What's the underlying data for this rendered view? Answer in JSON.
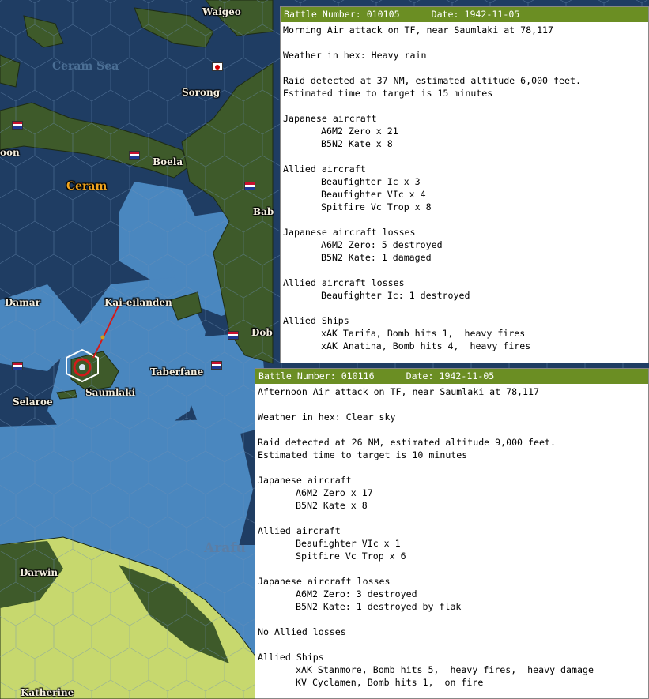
{
  "map": {
    "labels": {
      "waigeo": "Waigeo",
      "ceram_sea": "Ceram Sea",
      "sorong": "Sorong",
      "boela": "Boela",
      "ceram": "Ceram",
      "bab": "Bab",
      "oon": "oon",
      "damar": "Damar",
      "kai": "Kai-eilanden",
      "dob": "Dob",
      "taberfane": "Taberfane",
      "selaroe": "Selaroe",
      "saumlaki": "Saumlaki",
      "arafura": "Arafu",
      "darwin": "Darwin",
      "katherine": "Katherine"
    },
    "colors": {
      "deep_water": "#1f3d63",
      "shallow_water": "#4a87bf",
      "land": "#3e5a2a",
      "australia_land": "#c7d86e",
      "header_green": "#6b8e23"
    }
  },
  "report1": {
    "battle_number": "Battle Number: 010105",
    "date": "Date: 1942-11-05",
    "lines": [
      {
        "text": "Morning Air attack on TF, near Saumlaki at 78,117",
        "indent": false
      },
      {
        "text": "",
        "indent": false
      },
      {
        "text": "Weather in hex: Heavy rain",
        "indent": false
      },
      {
        "text": "",
        "indent": false
      },
      {
        "text": "Raid detected at 37 NM, estimated altitude 6,000 feet.",
        "indent": false
      },
      {
        "text": "Estimated time to target is 15 minutes",
        "indent": false
      },
      {
        "text": "",
        "indent": false
      },
      {
        "text": "Japanese aircraft",
        "indent": false
      },
      {
        "text": "A6M2 Zero x 21",
        "indent": true
      },
      {
        "text": "B5N2 Kate x 8",
        "indent": true
      },
      {
        "text": "",
        "indent": false
      },
      {
        "text": "Allied aircraft",
        "indent": false
      },
      {
        "text": "Beaufighter Ic x 3",
        "indent": true
      },
      {
        "text": "Beaufighter VIc x 4",
        "indent": true
      },
      {
        "text": "Spitfire Vc Trop x 8",
        "indent": true
      },
      {
        "text": "",
        "indent": false
      },
      {
        "text": "Japanese aircraft losses",
        "indent": false
      },
      {
        "text": "A6M2 Zero: 5 destroyed",
        "indent": true
      },
      {
        "text": "B5N2 Kate: 1 damaged",
        "indent": true
      },
      {
        "text": "",
        "indent": false
      },
      {
        "text": "Allied aircraft losses",
        "indent": false
      },
      {
        "text": "Beaufighter Ic: 1 destroyed",
        "indent": true
      },
      {
        "text": "",
        "indent": false
      },
      {
        "text": "Allied Ships",
        "indent": false
      },
      {
        "text": "xAK Tarifa, Bomb hits 1,  heavy fires",
        "indent": true
      },
      {
        "text": "xAK Anatina, Bomb hits 4,  heavy fires",
        "indent": true
      }
    ]
  },
  "report2": {
    "battle_number": "Battle Number: 010116",
    "date": "Date: 1942-11-05",
    "lines": [
      {
        "text": "Afternoon Air attack on TF, near Saumlaki at 78,117",
        "indent": false
      },
      {
        "text": "",
        "indent": false
      },
      {
        "text": "Weather in hex: Clear sky",
        "indent": false
      },
      {
        "text": "",
        "indent": false
      },
      {
        "text": "Raid detected at 26 NM, estimated altitude 9,000 feet.",
        "indent": false
      },
      {
        "text": "Estimated time to target is 10 minutes",
        "indent": false
      },
      {
        "text": "",
        "indent": false
      },
      {
        "text": "Japanese aircraft",
        "indent": false
      },
      {
        "text": "A6M2 Zero x 17",
        "indent": true
      },
      {
        "text": "B5N2 Kate x 8",
        "indent": true
      },
      {
        "text": "",
        "indent": false
      },
      {
        "text": "Allied aircraft",
        "indent": false
      },
      {
        "text": "Beaufighter VIc x 1",
        "indent": true
      },
      {
        "text": "Spitfire Vc Trop x 6",
        "indent": true
      },
      {
        "text": "",
        "indent": false
      },
      {
        "text": "Japanese aircraft losses",
        "indent": false
      },
      {
        "text": "A6M2 Zero: 3 destroyed",
        "indent": true
      },
      {
        "text": "B5N2 Kate: 1 destroyed by flak",
        "indent": true
      },
      {
        "text": "",
        "indent": false
      },
      {
        "text": "No Allied losses",
        "indent": false
      },
      {
        "text": "",
        "indent": false
      },
      {
        "text": "Allied Ships",
        "indent": false
      },
      {
        "text": "xAK Stanmore, Bomb hits 5,  heavy fires,  heavy damage",
        "indent": true
      },
      {
        "text": "KV Cyclamen, Bomb hits 1,  on fire",
        "indent": true
      }
    ]
  }
}
